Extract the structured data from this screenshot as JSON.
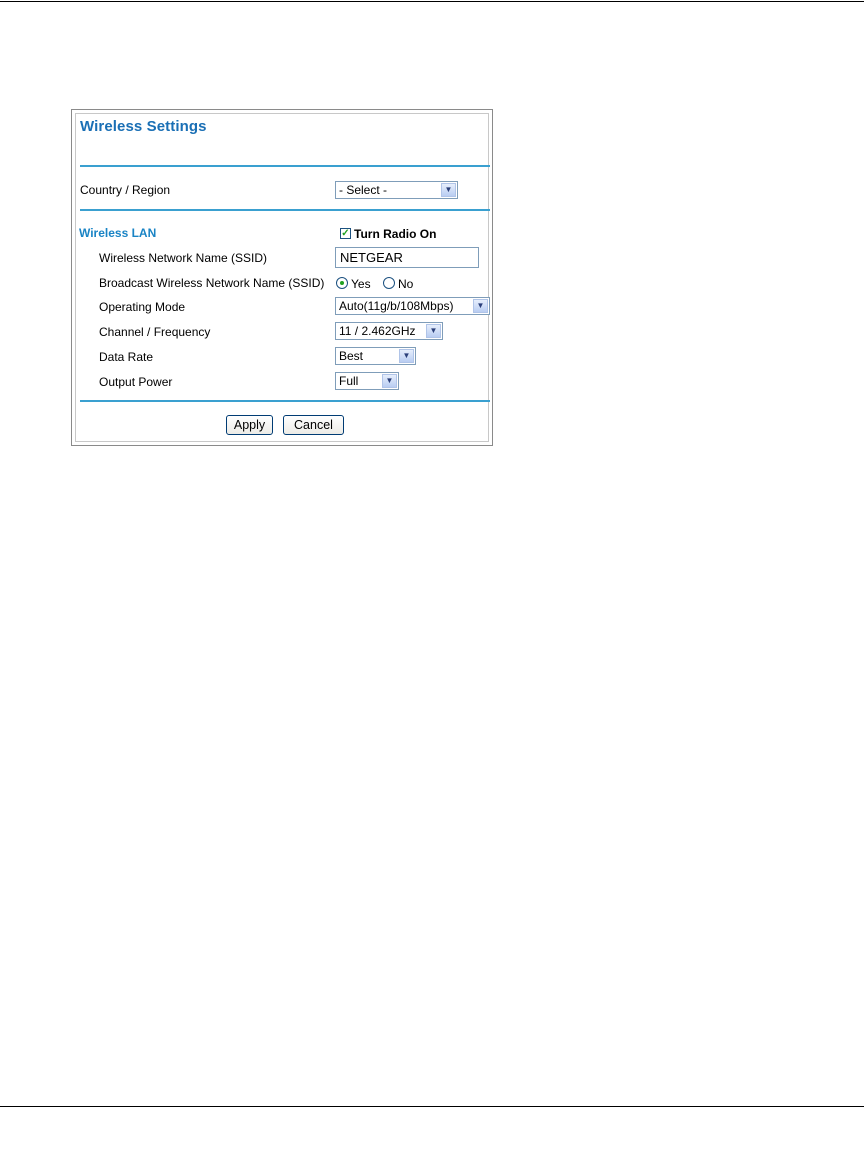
{
  "page": {
    "title": "Wireless Settings"
  },
  "country": {
    "label": "Country / Region",
    "selected": "- Select -"
  },
  "wireless_lan": {
    "section_label": "Wireless LAN",
    "turn_radio_on": {
      "label": "Turn Radio On",
      "checked": true
    },
    "ssid": {
      "label": "Wireless Network Name (SSID)",
      "value": "NETGEAR"
    },
    "broadcast": {
      "label": "Broadcast Wireless Network Name (SSID)",
      "options": [
        "Yes",
        "No"
      ],
      "selected": "Yes"
    },
    "operating_mode": {
      "label": "Operating Mode",
      "selected": "Auto(11g/b/108Mbps)"
    },
    "channel": {
      "label": "Channel / Frequency",
      "selected": "11 / 2.462GHz"
    },
    "data_rate": {
      "label": "Data Rate",
      "selected": "Best"
    },
    "output_power": {
      "label": "Output Power",
      "selected": "Full"
    }
  },
  "buttons": {
    "apply": "Apply",
    "cancel": "Cancel"
  },
  "icons": {
    "dropdown": "chevron-down-icon",
    "check": "checkmark-icon",
    "radio": "radio-dot-icon"
  }
}
